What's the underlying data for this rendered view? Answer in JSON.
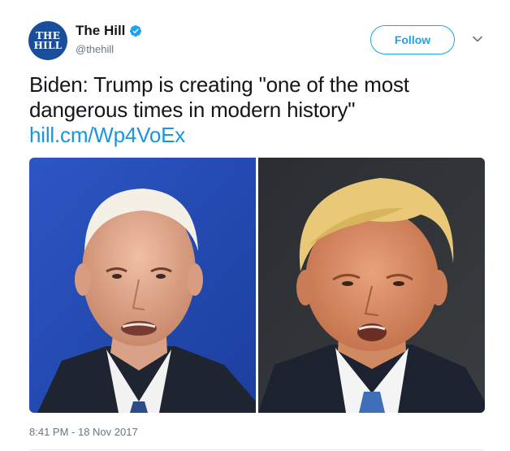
{
  "account": {
    "display_name": "The Hill",
    "handle": "@thehill",
    "avatar_text_top": "THE",
    "avatar_text_bottom": "HILL",
    "verified": true
  },
  "actions": {
    "follow_label": "Follow",
    "more_icon": "chevron-down-icon"
  },
  "tweet": {
    "text": "Biden: Trump is creating \"one of the most dangerous times in modern history\" ",
    "link_text": "hill.cm/Wp4VoEx",
    "timestamp": "8:41 PM - 18 Nov 2017"
  },
  "media": {
    "photos": [
      {
        "subject": "Joe Biden"
      },
      {
        "subject": "Donald Trump"
      }
    ]
  },
  "colors": {
    "brand_blue": "#1da1f2",
    "link_blue": "#1b95e0",
    "avatar_bg": "#1b4e9a",
    "muted_text": "#657786"
  }
}
